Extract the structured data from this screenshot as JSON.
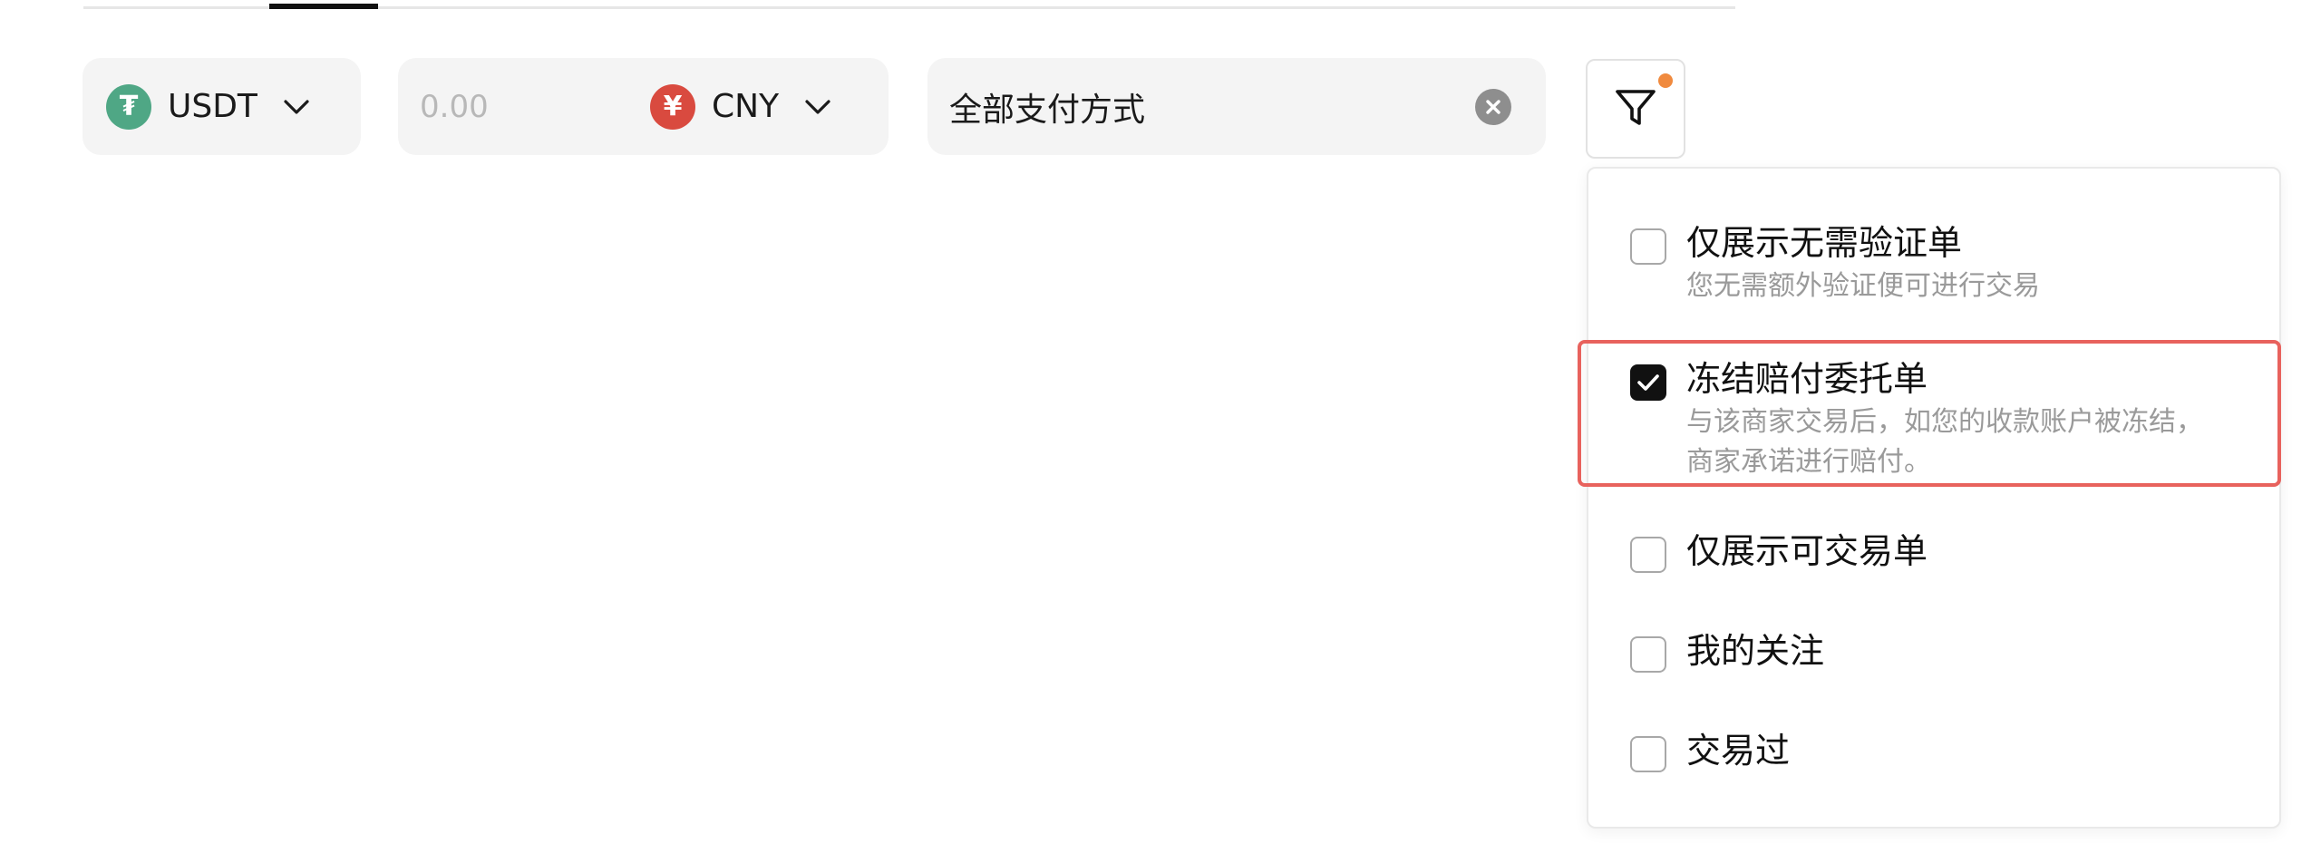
{
  "colors": {
    "usdt": "#4fa785",
    "cny": "#d94a3f",
    "filter_dot": "#f08a3e",
    "highlight": "#e8625d",
    "pill_bg": "#f4f4f4"
  },
  "coin_select": {
    "icon": "tether-icon",
    "icon_glyph": "₮",
    "label": "USDT"
  },
  "amount": {
    "placeholder": "0.00",
    "value": ""
  },
  "fiat_select": {
    "icon": "yuan-icon",
    "icon_glyph": "¥",
    "label": "CNY"
  },
  "payment": {
    "label": "全部支付方式"
  },
  "filter": {
    "icon": "filter-icon",
    "has_active_indicator": true
  },
  "filter_options": [
    {
      "title": "仅展示无需验证单",
      "desc": "您无需额外验证便可进行交易",
      "checked": false
    },
    {
      "title": "冻结赔付委托单",
      "desc": "与该商家交易后，如您的收款账户被冻结，商家承诺进行赔付。",
      "checked": true
    },
    {
      "title": "仅展示可交易单",
      "desc": "",
      "checked": false
    },
    {
      "title": "我的关注",
      "desc": "",
      "checked": false
    },
    {
      "title": "交易过",
      "desc": "",
      "checked": false
    }
  ]
}
